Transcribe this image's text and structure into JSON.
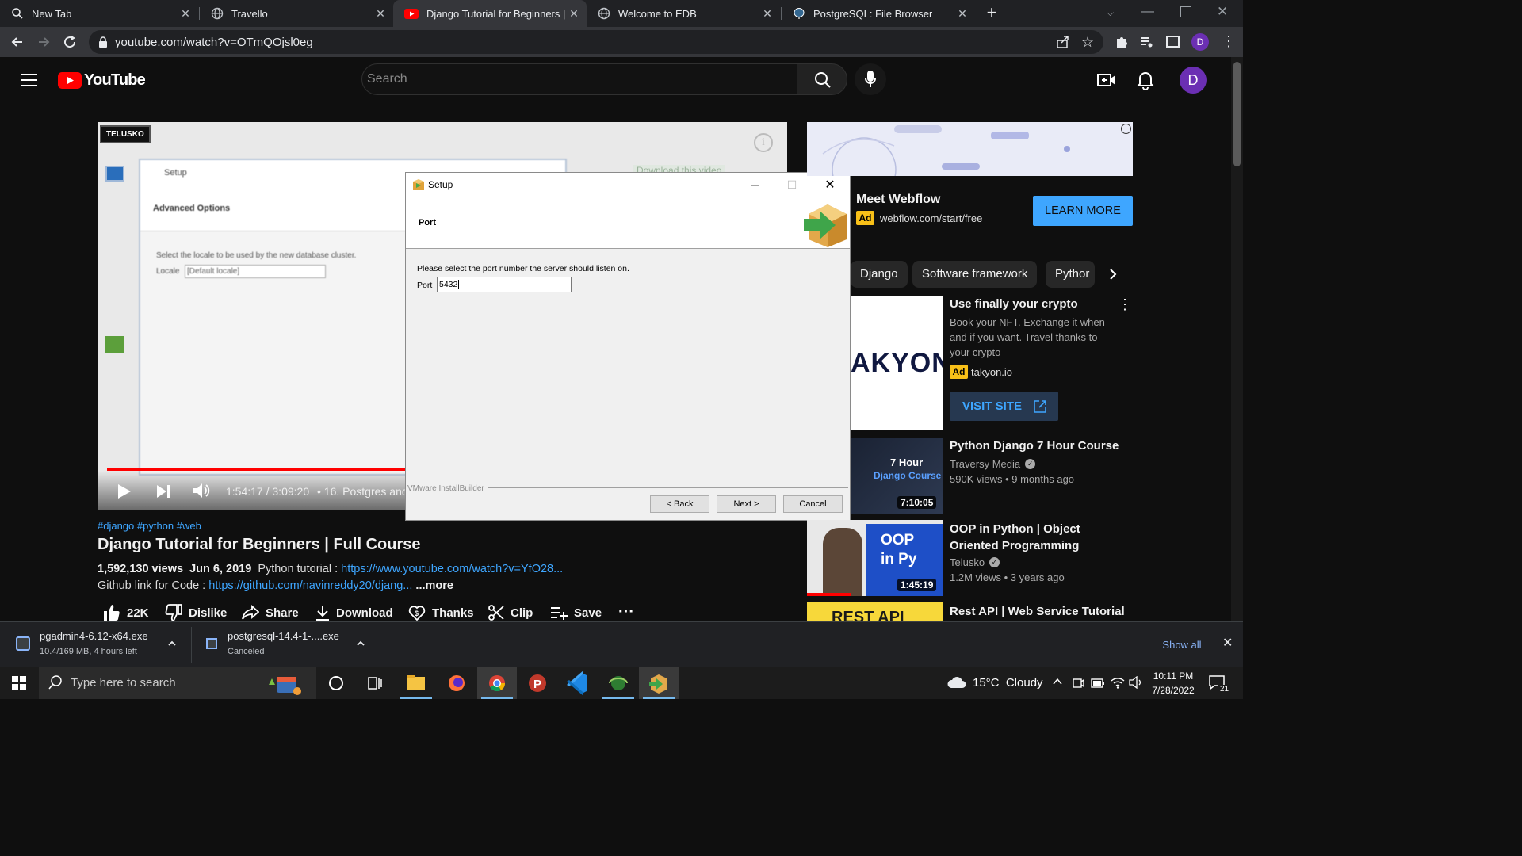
{
  "browser": {
    "tabs": [
      {
        "title": "New Tab",
        "icon": "search-icon"
      },
      {
        "title": "Travello",
        "icon": "globe-icon"
      },
      {
        "title": "Django Tutorial for Beginners | F",
        "icon": "youtube-icon",
        "active": true
      },
      {
        "title": "Welcome to EDB",
        "icon": "globe-icon"
      },
      {
        "title": "PostgreSQL: File Browser",
        "icon": "postgres-elephant-icon"
      }
    ],
    "url": "youtube.com/watch?v=OTmQOjsl0eg",
    "profile_initial": "D"
  },
  "youtube": {
    "logo_text": "YouTube",
    "search_placeholder": "Search",
    "avatar_initial": "D"
  },
  "video": {
    "channel_watermark": "TELUSKO",
    "time_current": "1:54:17",
    "time_total": "3:09:20",
    "chapter": "• 16. Postgres and P",
    "progress_fraction": 0.604,
    "bg_setup_title": "Setup",
    "bg_setup_heading": "Advanced Options",
    "bg_setup_text": "Select the locale to be used by the new database cluster.",
    "bg_locale_label": "Locale",
    "bg_locale_value": "[Default locale]",
    "bg_download_label": "Download this video"
  },
  "setup_dialog": {
    "title": "Setup",
    "heading": "Port",
    "instruction": "Please select the port number the server should listen on.",
    "port_label": "Port",
    "port_value": "5432",
    "footer_brand": "VMware InstallBuilder",
    "back_label": "< Back",
    "next_label": "Next >",
    "cancel_label": "Cancel"
  },
  "details": {
    "hashtags": "#django #python #web",
    "title": "Django Tutorial for Beginners | Full Course",
    "views": "1,592,130 views",
    "date": "Jun 6, 2019",
    "desc_prefix": "Python tutorial :",
    "desc_link": "https://www.youtube.com/watch?v=YfO28...",
    "github_prefix": "Github link for Code :",
    "github_link": "https://github.com/navinreddy20/djang...",
    "more_label": "...more",
    "actions": {
      "likes": "22K",
      "dislike": "Dislike",
      "share": "Share",
      "download": "Download",
      "thanks": "Thanks",
      "clip": "Clip",
      "save": "Save"
    }
  },
  "sidebar": {
    "ad_top": {
      "title": "Meet Webflow",
      "ad_badge": "Ad",
      "domain": "webflow.com/start/free",
      "cta": "LEARN MORE"
    },
    "chips": [
      "Django",
      "Software framework",
      "Pythor"
    ],
    "ad_crypto": {
      "title": "Use finally your crypto",
      "desc": "Book your NFT. Exchange it when and if you want. Travel thanks to your crypto",
      "ad_badge": "Ad",
      "domain": "takyon.io",
      "cta": "VISIT SITE",
      "thumb_text": "AKYON"
    },
    "videos": [
      {
        "title": "Python Django 7 Hour Course",
        "channel": "Traversy Media",
        "meta": "590K views • 9 months ago",
        "duration": "7:10:05",
        "thumb_line1": "7 Hour",
        "thumb_line2": "Django Course"
      },
      {
        "title": "OOP in Python | Object Oriented Programming",
        "channel": "Telusko",
        "meta": "1.2M views • 3 years ago",
        "duration": "1:45:19",
        "thumb_text": "OOP in Py"
      },
      {
        "title": "Rest API | Web Service Tutorial",
        "thumb_text": "REST API"
      }
    ]
  },
  "downloads": [
    {
      "name": "pgadmin4-6.12-x64.exe",
      "status": "10.4/169 MB, 4 hours left"
    },
    {
      "name": "postgresql-14.4-1-....exe",
      "status": "Canceled"
    }
  ],
  "downloads_show_all": "Show all",
  "taskbar": {
    "search_placeholder": "Type here to search",
    "weather": "15°C  Cloudy",
    "time": "10:11 PM",
    "date": "7/28/2022",
    "notification_count": "21"
  },
  "colors": {
    "youtube_red": "#ff0000",
    "link_blue": "#3ea6ff",
    "avatar_purple": "#6b2fb3",
    "cta_blue": "#3ea6ff",
    "ad_badge_yellow": "#f8c018"
  }
}
